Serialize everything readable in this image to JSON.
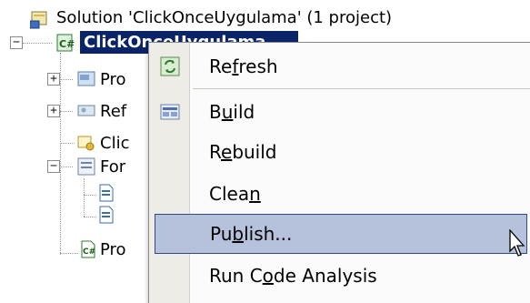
{
  "tree": {
    "solution_label": "Solution 'ClickOnceUygulama' (1 project)",
    "project_label": "ClickOnceUygulama",
    "items": [
      {
        "label": "Pro"
      },
      {
        "label": "Ref"
      },
      {
        "label": "Clic"
      },
      {
        "label": "For"
      },
      {
        "label": "Pro"
      }
    ]
  },
  "menu": {
    "items": [
      {
        "pre": "Re",
        "mn": "f",
        "post": "resh",
        "icon": "refresh-icon"
      },
      {
        "pre": "B",
        "mn": "u",
        "post": "ild",
        "icon": "build-icon"
      },
      {
        "pre": "R",
        "mn": "e",
        "post": "build",
        "icon": ""
      },
      {
        "pre": "Clea",
        "mn": "n",
        "post": "",
        "icon": ""
      },
      {
        "pre": "Pu",
        "mn": "b",
        "post": "lish...",
        "icon": ""
      },
      {
        "pre": "Run C",
        "mn": "o",
        "post": "de Analysis",
        "icon": ""
      }
    ],
    "hover_index": 4
  },
  "colors": {
    "selection": "#0a246a",
    "menu_hover": "#b6c2db",
    "menu_hover_border": "#304a86",
    "gutter": "#eeece6"
  }
}
